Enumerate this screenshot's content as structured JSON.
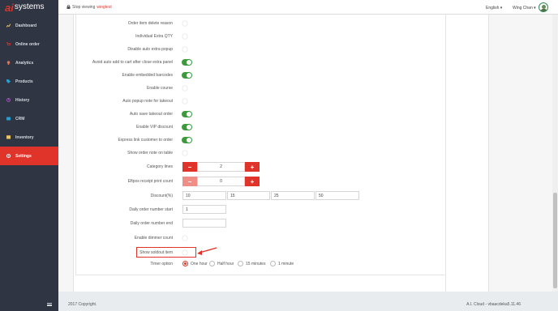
{
  "sidebar": {
    "logo_mark": "ai",
    "logo_text": "systems",
    "items": [
      {
        "label": "Dashboard",
        "icon": "chart-line-icon",
        "color": "#e9c46a"
      },
      {
        "label": "Online order",
        "icon": "cart-icon",
        "color": "#e0342a"
      },
      {
        "label": "Analytics",
        "icon": "bulb-icon",
        "color": "#e76f51"
      },
      {
        "label": "Products",
        "icon": "tag-icon",
        "color": "#2a9dcc"
      },
      {
        "label": "History",
        "icon": "history-icon",
        "color": "#9b59b6"
      },
      {
        "label": "CRM",
        "icon": "crm-icon",
        "color": "#2a9dcc"
      },
      {
        "label": "Inventory",
        "icon": "inventory-icon",
        "color": "#e9c46a"
      },
      {
        "label": "Settings",
        "icon": "settings-icon",
        "color": "#ffffff"
      }
    ],
    "active": "Settings"
  },
  "topbar": {
    "stop_viewing": "Stop viewing",
    "store": "wingtest",
    "language": "English",
    "user": "Wing Chan"
  },
  "settings": {
    "toggles": [
      {
        "label": "Order item delete reason",
        "on": false
      },
      {
        "label": "Individual Extra QTY",
        "on": false
      },
      {
        "label": "Disable auto extra popup",
        "on": false
      },
      {
        "label": "Avoid auto add to cart after close extra panel",
        "on": true
      },
      {
        "label": "Enable embedded barcodes",
        "on": true
      },
      {
        "label": "Enable course",
        "on": false
      },
      {
        "label": "Auto popup note for takeout",
        "on": false
      },
      {
        "label": "Auto save takeout order",
        "on": true
      },
      {
        "label": "Enable VIP discount",
        "on": true
      },
      {
        "label": "Express link customer to order",
        "on": true
      },
      {
        "label": "Show order note on table",
        "on": false
      }
    ],
    "category_lines": {
      "label": "Category lines",
      "value": "2"
    },
    "eftpos_count": {
      "label": "Eftpos receipt print count",
      "value": "0"
    },
    "discount": {
      "label": "Discount(%)",
      "values": [
        "10",
        "15",
        "25",
        "50"
      ]
    },
    "daily_start": {
      "label": "Daily order number start",
      "value": "1"
    },
    "daily_end": {
      "label": "Daily order number end",
      "value": ""
    },
    "dimmer_count": {
      "label": "Enable dimmer count",
      "on": false
    },
    "show_soldout": {
      "label": "Show soldout item",
      "on": false
    },
    "timer": {
      "label": "Timer option",
      "options": [
        "One hour",
        "Half hour",
        "15 minutes",
        "1 minute"
      ],
      "selected": "One hour"
    },
    "minus": "−",
    "plus": "+"
  },
  "footer": {
    "copyright": "2017 Copyright.",
    "version": "A.I. Cloud - vbaacdeka5.11.46"
  },
  "colors": {
    "accent": "#e0342a",
    "toggle_on": "#3c9a3c",
    "sidebar_bg": "#2f3542"
  }
}
